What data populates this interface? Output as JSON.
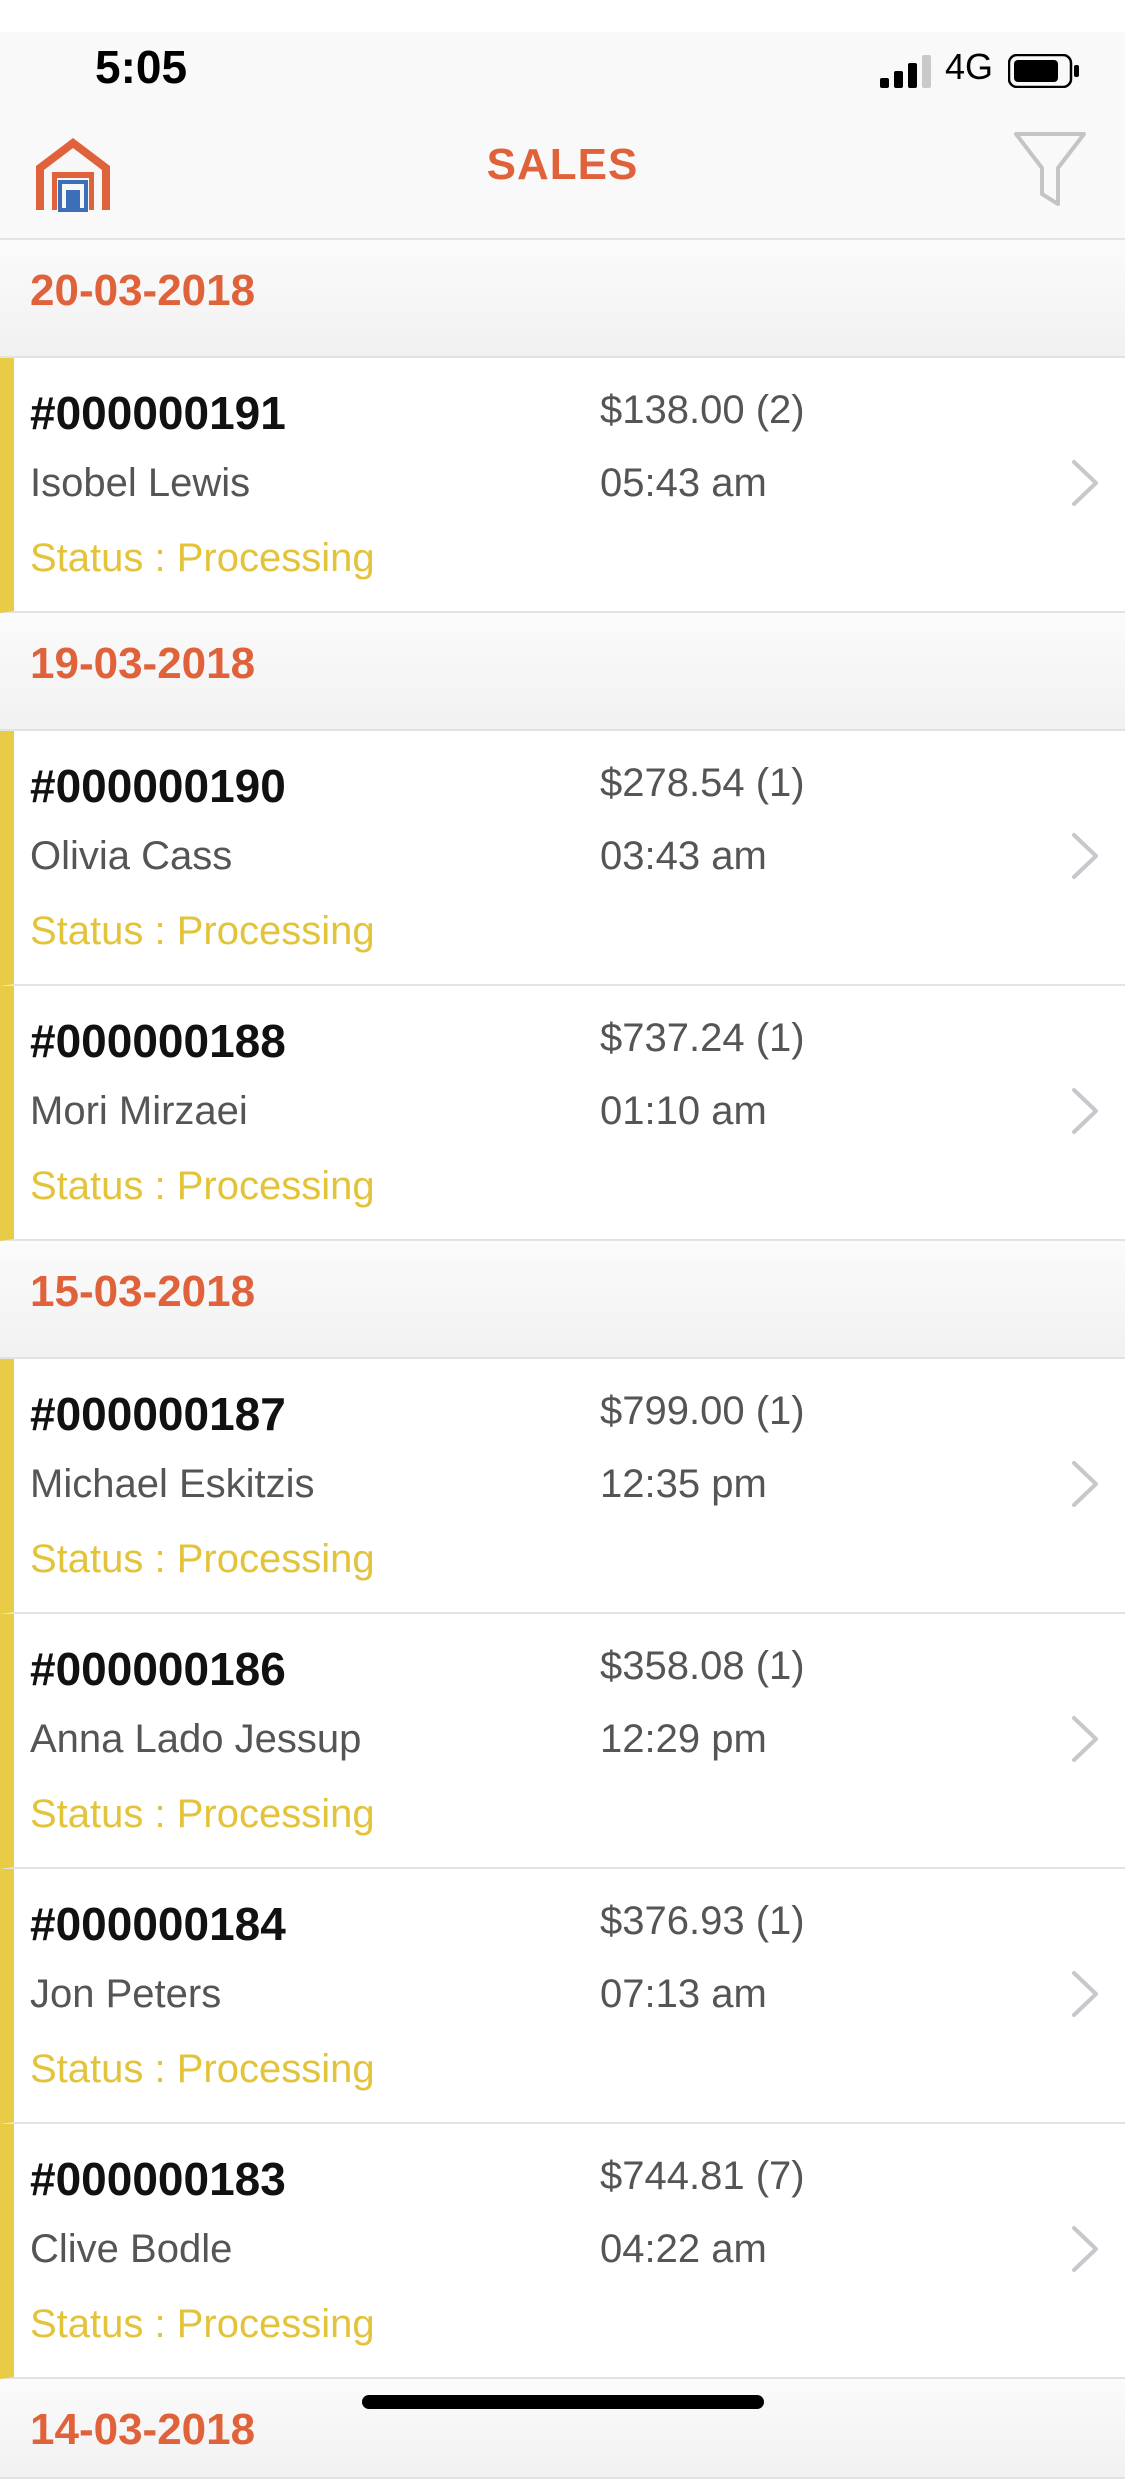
{
  "status_bar": {
    "time": "5:05",
    "network": "4G"
  },
  "nav": {
    "title": "SALES",
    "home_icon": "warehouse-icon",
    "filter_icon": "filter-funnel-icon"
  },
  "colors": {
    "accent": "#e0623b",
    "status": "#e3c33a",
    "row_bar": "#e9cc46"
  },
  "groups": [
    {
      "date": "20-03-2018",
      "orders": [
        {
          "number": "#000000191",
          "customer": "Isobel Lewis",
          "status": "Status : Processing",
          "amount": "$138.00 (2)",
          "time": "05:43 am"
        }
      ]
    },
    {
      "date": "19-03-2018",
      "orders": [
        {
          "number": "#000000190",
          "customer": "Olivia Cass",
          "status": "Status : Processing",
          "amount": "$278.54 (1)",
          "time": "03:43 am"
        },
        {
          "number": "#000000188",
          "customer": "Mori Mirzaei",
          "status": "Status : Processing",
          "amount": "$737.24 (1)",
          "time": "01:10 am"
        }
      ]
    },
    {
      "date": "15-03-2018",
      "orders": [
        {
          "number": "#000000187",
          "customer": "Michael Eskitzis",
          "status": "Status : Processing",
          "amount": "$799.00 (1)",
          "time": "12:35 pm"
        },
        {
          "number": "#000000186",
          "customer": "Anna Lado Jessup",
          "status": "Status : Processing",
          "amount": "$358.08 (1)",
          "time": "12:29 pm"
        },
        {
          "number": "#000000184",
          "customer": "Jon Peters",
          "status": "Status : Processing",
          "amount": "$376.93 (1)",
          "time": "07:13 am"
        },
        {
          "number": "#000000183",
          "customer": "Clive Bodle",
          "status": "Status : Processing",
          "amount": "$744.81 (7)",
          "time": "04:22 am"
        }
      ]
    },
    {
      "date": "14-03-2018",
      "orders": []
    }
  ]
}
